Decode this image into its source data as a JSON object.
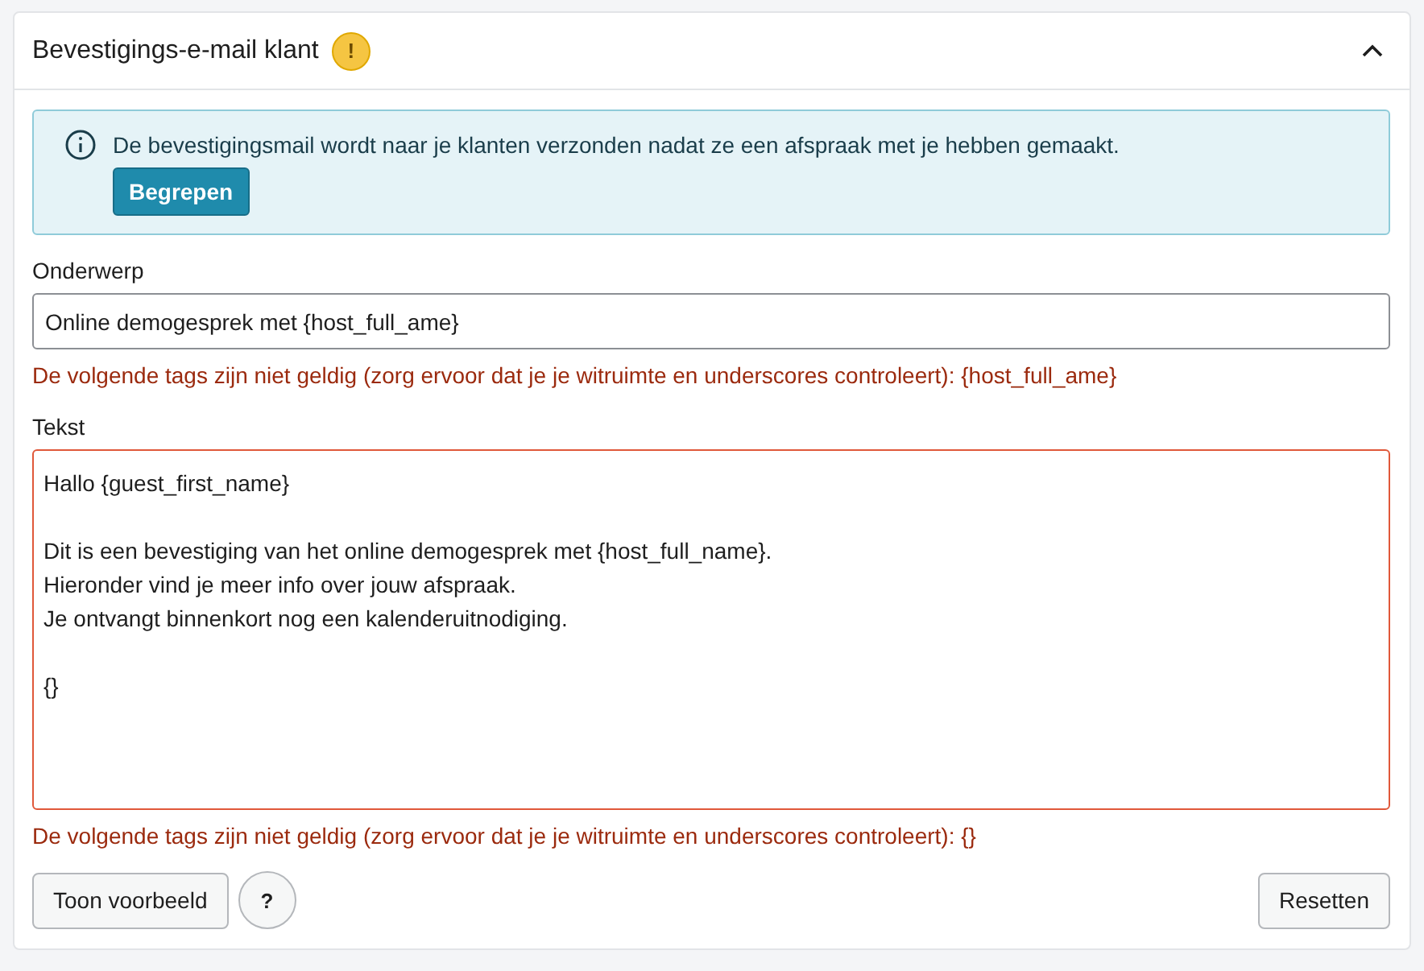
{
  "panel": {
    "title": "Bevestigings-e-mail klant",
    "warning_badge": "!",
    "expanded": true
  },
  "notice": {
    "text": "De bevestigingsmail wordt naar je klanten verzonden nadat ze een afspraak met je hebben gemaakt.",
    "button": "Begrepen"
  },
  "fields": [
    {
      "kind": "input",
      "label": "Onderwerp",
      "value": "Online demogesprek met {host_full_ame}",
      "invalid": false,
      "error": "De volgende tags zijn niet geldig (zorg ervoor dat je je witruimte en underscores controleert): {host_full_ame}"
    },
    {
      "kind": "textarea",
      "label": "Tekst",
      "value": "Hallo {guest_first_name}\n\nDit is een bevestiging van het online demogesprek met {host_full_name}.\nHieronder vind je meer info over jouw afspraak.\nJe ontvangt binnenkort nog een kalenderuitnodiging.\n\n{}",
      "invalid": true,
      "error": "De volgende tags zijn niet geldig (zorg ervoor dat je je witruimte en underscores controleert): {}"
    }
  ],
  "footer": {
    "preview_button": "Toon voorbeeld",
    "help_button": "?",
    "reset_button": "Resetten"
  }
}
